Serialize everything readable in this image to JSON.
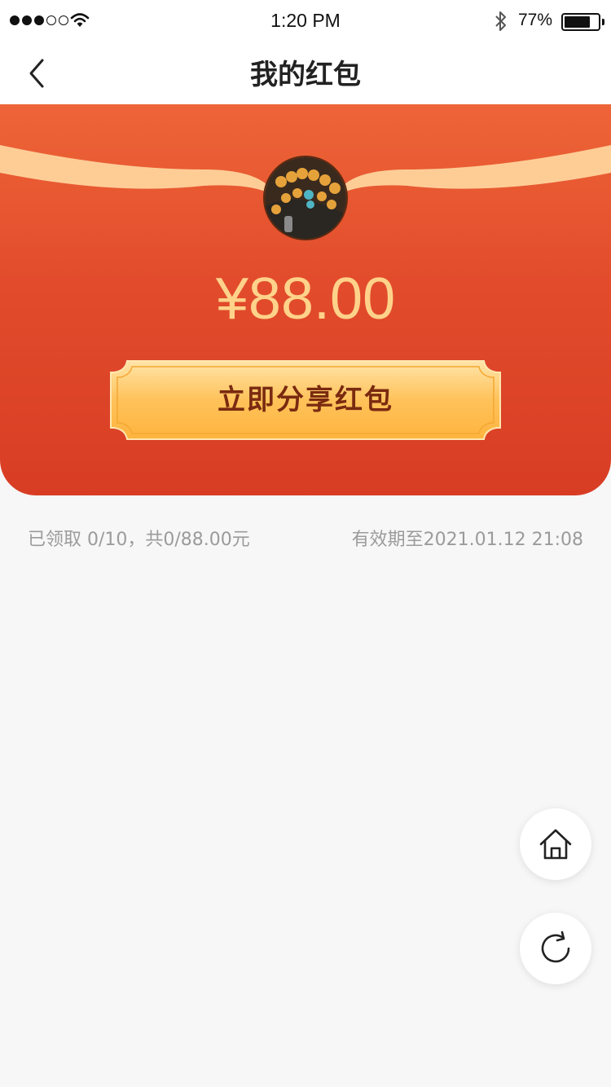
{
  "status_bar": {
    "time": "1:20 PM",
    "battery_percent": "77%",
    "battery_level": 0.77,
    "signal_strength": 3,
    "icons": [
      "signal-dots",
      "wifi-icon",
      "bluetooth-icon",
      "battery-icon"
    ]
  },
  "nav": {
    "title": "我的红包",
    "back_icon": "chevron-left-icon"
  },
  "red_packet": {
    "amount": "¥88.00",
    "share_button_label": "立即分享红包",
    "colors": {
      "gradient_top": "#ee6538",
      "gradient_bottom": "#d83d24",
      "amount_text": "#ffd28a",
      "button_fill": "#ffb947",
      "button_text": "#7a2a10"
    }
  },
  "info": {
    "claimed": "已领取 0/10，共0/88.00元",
    "expiry": "有效期至2021.01.12 21:08"
  },
  "floating_buttons": {
    "home_icon": "home-icon",
    "refresh_icon": "refresh-icon"
  }
}
